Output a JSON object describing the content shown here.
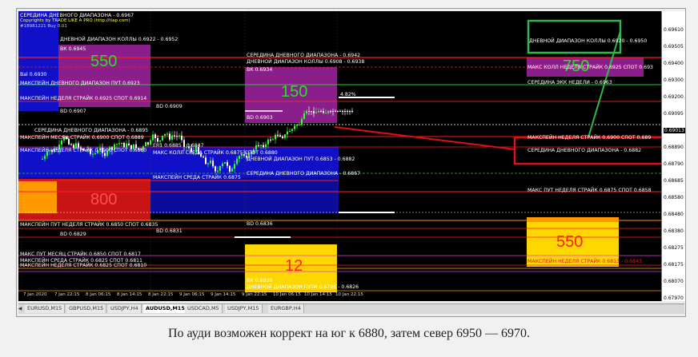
{
  "window": {
    "header_lines": [
      "СЕРЕДИНА ДНЕВНОГО ДИАПАЗОНА - 0.6967",
      "Copyrights by TRADE LIKE A PRO (http://tlap.com)",
      "#18981221 Buy 0.01"
    ]
  },
  "boxes": {
    "weekly_left": {
      "number": "550",
      "top_label": "ВК 0.6945",
      "bottom_label": "Bal 0.6930"
    },
    "daily_purple": {
      "number": "150",
      "top_label": "ВК 0.6934",
      "bottom_label": "ВD 0.6903"
    },
    "red_mid": {
      "number": "800"
    },
    "right_orange": {
      "number": "550"
    },
    "right_purple": {
      "number": "750"
    },
    "yellow_bottom": {
      "number": "12",
      "bottom_label": "ВК 0.6808"
    }
  },
  "labels": [
    "ДНЕВНОЙ ДИАПАЗОН КОЛЛЫ 0.6922 - 0.6952",
    "СЕРЕДИНА ДНЕВНОГО ДИАПАЗОНА - 0.6942",
    "ДНЕВНОЙ ДИАПАЗОН КОЛЛЫ 0.6908 - 0.6938",
    "МАКСПЕЙН ДНЕВНОГО ДИАПАЗОН ПУТ 0.6923",
    "МАКСПЕЙН НЕДЕЛЯ СТРАЙК 0.6925 СПОТ 0.6914",
    "ВD 0.6907",
    "ВD 0.6909",
    "4.82%",
    "СЕРЕДИНА ДНЕВНОГО ДИАПАЗОНА - 0.6895",
    "МАКСПЕЙН МЕСЯЦ СТРАЙК 0.6900 СПОТ 0.6889",
    "ER1 0.6885 - 0.6847",
    "МАКСПЕЙН НЕДЕЛЯ СТРАЙК 0.6900 СПОТ 0.6880",
    "МАКС КОЛЛ СРЕДА СТРАЙК 0.6875 СПОТ 0.6880",
    "ДНЕВНОЙ ДИАПАЗОН ПУТ 0.6853 - 0.6882",
    "МАКСПЕЙН СРЕДА СТРАЙК 0.6875",
    "СЕРЕДИНА ДНЕВНОГО ДИАПАЗОНА - 0.6867",
    "ВD 0.6829",
    "ВD 0.6831",
    "ВD 0.6836",
    "МАКСПЕЙН ПУТ НЕДЕЛЯ СТРАЙК 0.6850 СПОТ 0.6835",
    "МАКС ПУТ МЕСЯЦ СТРАЙК 0.6850 СПОТ 0.6817",
    "МАКСПЕЙН СРЕДА СТРАЙК 0.6825 СПОТ 0.6811",
    "МАКСПЕЙН НЕДЕЛЯ СТРАЙК 0.6825 СПОТ 0.6810",
    "ДНЕВНОЙ ДИАПАЗОН ПУТИ 0.6796 - 0.6826"
  ],
  "right_labels": {
    "r1": "ДНЕВНОЙ ДИАПАЗОН КОЛЛЫ 0.6920 - 0.6950",
    "r2": "МАКС КОЛЛ НЕДЕЛЯ СТРАЙК 0.6925 СПОТ 0.693",
    "r3": "СЕРЕДИНА ЭКК НЕДЕЛИ - 0.6963",
    "r4": "МАКСПЕЙН НЕДЕЛЯ СТРАЙК 0.6900 СПОТ 0.689",
    "r5": "СЕРЕДИНА ДНЕВНОГО ДИАПАЗОНА - 0.6882",
    "r6": "МАКС ПУТ НЕДЕЛЯ СТРАЙК 0.6875 СПОТ 0.6858",
    "r7": "МАКСПЕЙН НЕДЕЛЯ СТРАЙК 0.6813 - 0.6843"
  },
  "price_scale": [
    "0.69610",
    "0.69505",
    "0.69400",
    "0.69300",
    "0.69200",
    "0.69095",
    "0.69013",
    "0.68890",
    "0.68790",
    "0.68685",
    "0.68580",
    "0.68480",
    "0.68380",
    "0.68275",
    "0.68175",
    "0.68070",
    "0.67970"
  ],
  "current_price": "0.69013",
  "time_axis": [
    "7 Jan 2020",
    "7 Jan 22:15",
    "8 Jan 06:15",
    "8 Jan 14:15",
    "8 Jan 22:15",
    "9 Jan 06:15",
    "9 Jan 14:15",
    "9 Jan 22:15",
    "10 Jan 06:15",
    "10 Jan 14:15",
    "10 Jan 22:15"
  ],
  "tabs": [
    "EURUSD,M15",
    "GBPUSD,M15",
    "USDJPY,H4",
    "AUDUSD,M15",
    "USDCAD,M5",
    "USDJPY,M15",
    "EURGBP,H4"
  ],
  "active_tab": "AUDUSD,M15",
  "caption": "По ауди возможен коррект на юг к 6880, затем север 6950 — 6970.",
  "colors": {
    "chart_bg": "#000000",
    "blue": "#1010c8",
    "purple": "#8a1e8a",
    "red_line": "#ff1a1a",
    "yellow": "#ffd700",
    "orange": "#ff9900",
    "green_line": "#22cc22",
    "annotation_green": "#2db84a",
    "annotation_red": "#e01010"
  }
}
